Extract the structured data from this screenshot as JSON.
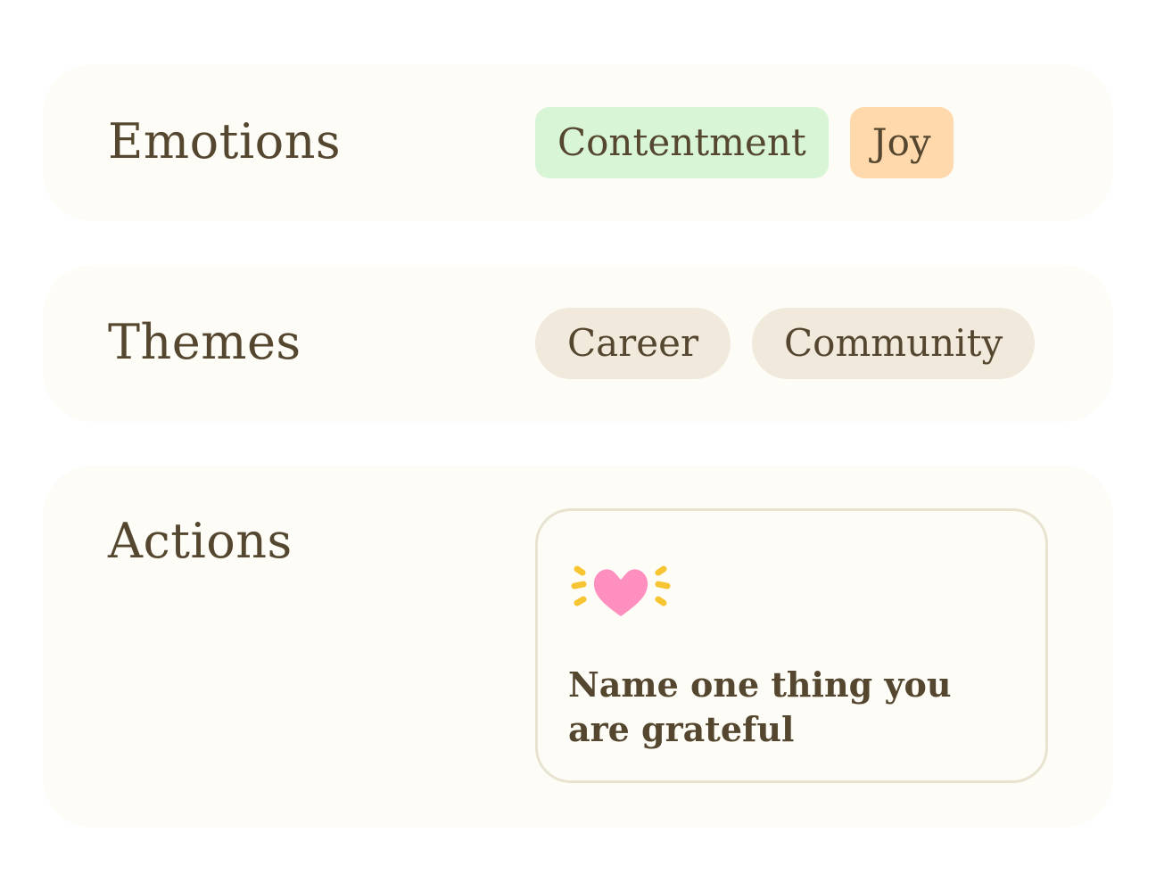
{
  "sections": {
    "emotions": {
      "label": "Emotions",
      "tags": [
        {
          "label": "Contentment",
          "color": "#d8f5d5"
        },
        {
          "label": "Joy",
          "color": "#ffd8ab"
        }
      ]
    },
    "themes": {
      "label": "Themes",
      "tags": [
        {
          "label": "Career",
          "color": "#f1e9db"
        },
        {
          "label": "Community",
          "color": "#f1e9db"
        }
      ]
    },
    "actions": {
      "label": "Actions",
      "items": [
        {
          "icon": "sparkling-heart-icon",
          "text": "Name one thing you are grateful"
        }
      ]
    }
  },
  "colors": {
    "text": "#55472f",
    "card_background": "#fdfcf6",
    "heart": "#ff8fbf",
    "sparkle": "#f7c531"
  }
}
